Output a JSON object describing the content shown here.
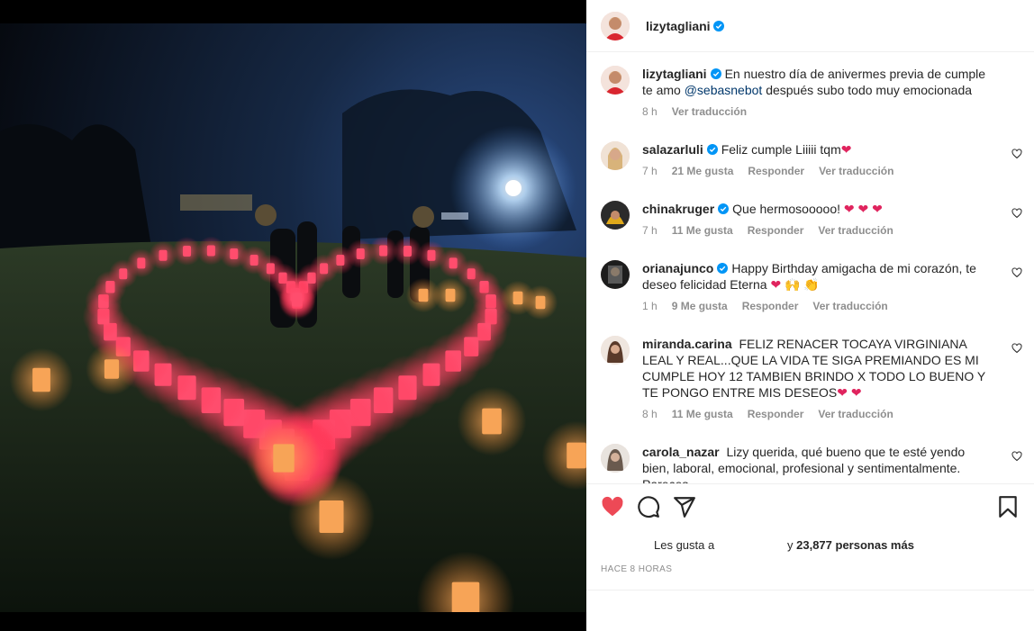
{
  "post": {
    "author": "lizytagliani",
    "caption_text": "En nuestro día de anivermes previa de cumple te amo",
    "caption_mention": "@sebasnebot",
    "caption_tail": "después subo todo muy emocionada",
    "caption_time": "8 h",
    "caption_translate": "Ver traducción"
  },
  "comments": [
    {
      "user": "salazarluli",
      "text": "Feliz cumple Liiiii tqm",
      "emoji": "❤",
      "time": "7 h",
      "likes": "21 Me gusta",
      "reply": "Responder",
      "translate": "Ver traducción",
      "avatar_color": "#caa27a"
    },
    {
      "user": "chinakruger",
      "text": "Que hermosooooo!",
      "emoji": "❤ ❤ ❤",
      "time": "7 h",
      "likes": "11 Me gusta",
      "reply": "Responder",
      "translate": "Ver traducción",
      "avatar_color": "#d9a31a"
    },
    {
      "user": "orianajunco",
      "text": "Happy Birthday amigacha de mi corazón, te deseo felicidad Eterna",
      "emoji": "❤ 🙌 👏",
      "time": "1 h",
      "likes": "9 Me gusta",
      "reply": "Responder",
      "translate": "Ver traducción",
      "avatar_color": "#2a2a2a"
    },
    {
      "user": "miranda.carina",
      "text": "FELIZ RENACER TOCAYA VIRGINIANA LEAL Y REAL...QUE LA VIDA TE SIGA PREMIANDO ES MI CUMPLE HOY 12 TAMBIEN BRINDO X TODO LO BUENO Y TE PONGO ENTRE MIS DESEOS",
      "emoji": "❤ ❤",
      "time": "8 h",
      "likes": "11 Me gusta",
      "reply": "Responder",
      "translate": "Ver traducción",
      "avatar_color": "#8a6a5a"
    },
    {
      "user": "carola_nazar",
      "text": "Lizy querida, qué bueno que te esté yendo bien, laboral, emocional, profesional y sentimentalmente. Pareces",
      "emoji": "",
      "time": "",
      "likes": "",
      "reply": "",
      "translate": "",
      "avatar_color": "#9a8f86"
    }
  ],
  "footer": {
    "likes_prefix": "Les gusta a",
    "likes_suffix": "y",
    "likes_count": "23,877 personas más",
    "time_ago": "HACE 8 HORAS"
  },
  "icons": [
    "heart-icon",
    "comment-icon",
    "share-icon",
    "bookmark-icon",
    "verified-badge-icon"
  ],
  "colors": {
    "like_red": "#ed4956",
    "verified_blue": "#0095f6",
    "muted": "#8e8e8e",
    "mention": "#00376b"
  }
}
